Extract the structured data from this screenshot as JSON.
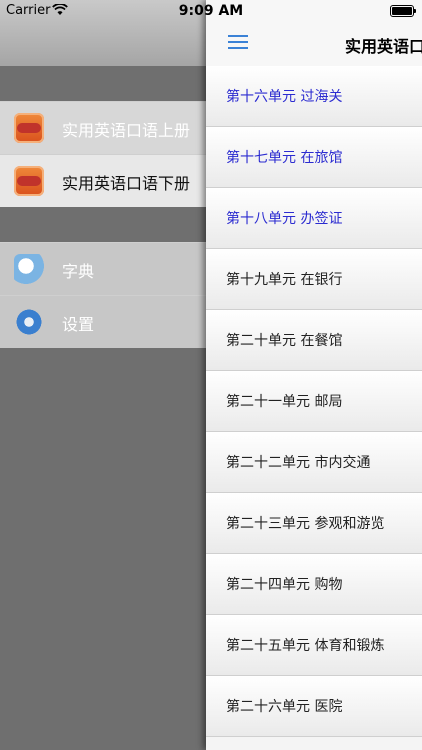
{
  "status_bar": {
    "carrier": "Carrier",
    "time": "9:09 AM"
  },
  "sidebar": {
    "books": [
      {
        "label": "实用英语口语上册",
        "icon": "app-icon"
      },
      {
        "label": "实用英语口语下册",
        "icon": "app-icon",
        "selected": true
      }
    ],
    "tools": [
      {
        "label": "字典",
        "icon": "dictionary-icon"
      },
      {
        "label": "设置",
        "icon": "gear-icon"
      }
    ]
  },
  "nav": {
    "title": "实用英语口"
  },
  "units": [
    {
      "label": "第十六单元 过海关",
      "color": "#2b2bd0"
    },
    {
      "label": "第十七单元 在旅馆",
      "color": "#2b2bd0"
    },
    {
      "label": "第十八单元 办签证",
      "color": "#2b2bd0"
    },
    {
      "label": "第十九单元 在银行",
      "color": "#222222"
    },
    {
      "label": "第二十单元 在餐馆",
      "color": "#222222"
    },
    {
      "label": "第二十一单元 邮局",
      "color": "#222222"
    },
    {
      "label": "第二十二单元 市内交通",
      "color": "#222222"
    },
    {
      "label": "第二十三单元 参观和游览",
      "color": "#222222"
    },
    {
      "label": "第二十四单元 购物",
      "color": "#222222"
    },
    {
      "label": "第二十五单元 体育和锻炼",
      "color": "#222222"
    },
    {
      "label": "第二十六单元 医院",
      "color": "#222222"
    }
  ]
}
